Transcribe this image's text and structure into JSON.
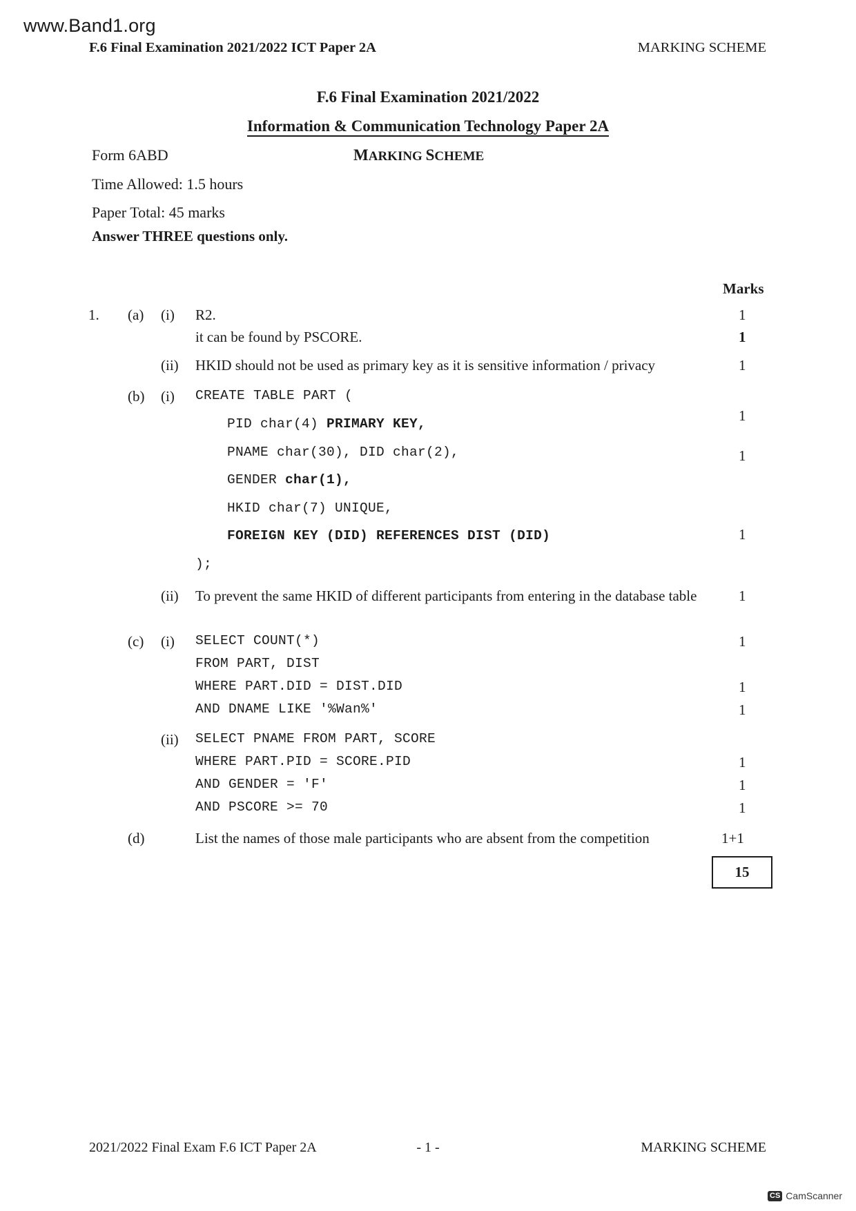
{
  "watermark": "www.Band1.org",
  "header": {
    "left": "F.6 Final Examination 2021/2022 ICT Paper 2A",
    "right": "MARKING SCHEME"
  },
  "titles": {
    "line1": "F.6 Final Examination 2021/2022",
    "line2": "Information & Communication Technology Paper 2A",
    "marking_scheme_big": "M",
    "marking_scheme_rest1": "ARKING ",
    "marking_scheme_big2": "S",
    "marking_scheme_rest2": "CHEME"
  },
  "meta": {
    "form": "Form 6ABD",
    "time": "Time Allowed: 1.5 hours",
    "total": "Paper Total: 45 marks",
    "answer": "Answer THREE questions only."
  },
  "marks_header": "Marks",
  "question": {
    "number": "1.",
    "parts": {
      "a": "(a)",
      "b": "(b)",
      "c": "(c)",
      "d": "(d)",
      "i": "(i)",
      "ii": "(ii)"
    }
  },
  "answers": {
    "a_i_line1": "R2.",
    "a_i_line2": "it can be found by PSCORE.",
    "a_i_mark1": "1",
    "a_i_mark2": "1",
    "a_ii": "HKID should not be used as primary key as it is sensitive information / privacy",
    "a_ii_mark": "1",
    "b_i": {
      "l1": "CREATE TABLE PART (",
      "l2a": "PID char(4) ",
      "l2b": "PRIMARY KEY,",
      "l3": "PNAME char(30), DID char(2),",
      "l4a": "GENDER ",
      "l4b": "char(1),",
      "l5": "HKID char(7) UNIQUE,",
      "l6": "FOREIGN KEY (DID) REFERENCES DIST (DID)",
      "l7": ");",
      "mark1": "1",
      "mark2": "1",
      "mark3": "1"
    },
    "b_ii": "To prevent the same HKID of different participants from entering in the database table",
    "b_ii_mark": "1",
    "c_i": {
      "l1": "SELECT COUNT(*)",
      "l2": "FROM PART, DIST",
      "l3": "WHERE PART.DID = DIST.DID",
      "l4": "AND DNAME LIKE '%Wan%'",
      "mark1": "1",
      "mark2": "1",
      "mark3": "1"
    },
    "c_ii": {
      "l1": "SELECT PNAME FROM PART, SCORE",
      "l2": "WHERE PART.PID = SCORE.PID",
      "l3": "AND GENDER = 'F'",
      "l4": "AND PSCORE >= 70",
      "mark1": "1",
      "mark2": "1",
      "mark3": "1"
    },
    "d": "List the names of those male participants who are absent from the competition",
    "d_mark": "1+1"
  },
  "total_box": "15",
  "footer": {
    "left": "2021/2022 Final Exam F.6 ICT Paper 2A",
    "center": "- 1 -",
    "right": "MARKING SCHEME"
  },
  "camscanner": {
    "badge": "CS",
    "label": "CamScanner"
  }
}
